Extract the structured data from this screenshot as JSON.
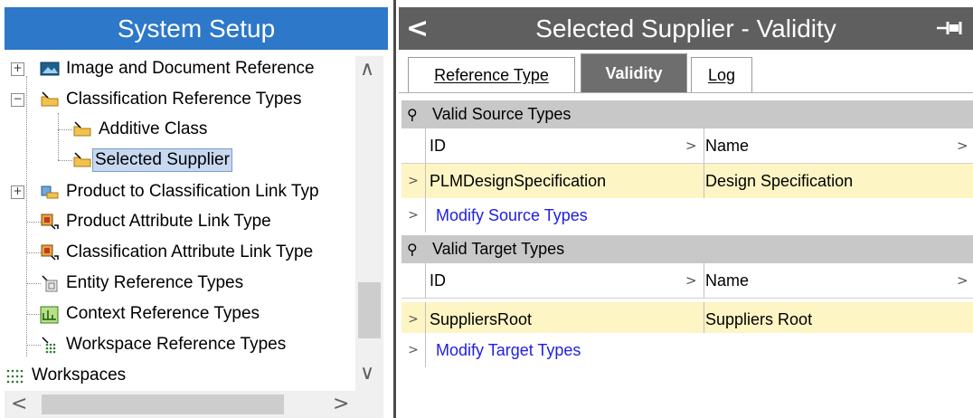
{
  "left": {
    "title": "System Setup",
    "tree": [
      {
        "label": "Image and Document Reference",
        "icon": "image-icon",
        "expander": "+"
      },
      {
        "label": "Classification Reference Types",
        "icon": "folder-ref-icon",
        "expander": "-"
      },
      {
        "label": "Additive Class",
        "icon": "folder-ref-icon"
      },
      {
        "label": "Selected Supplier",
        "icon": "folder-ref-icon",
        "selected": true
      },
      {
        "label": "Product to Classification Link Typ",
        "icon": "product-link-icon",
        "expander": "+"
      },
      {
        "label": "Product Attribute Link Type",
        "icon": "attribute-link-icon"
      },
      {
        "label": "Classification Attribute Link Type",
        "icon": "attribute-link-icon"
      },
      {
        "label": "Entity Reference Types",
        "icon": "entity-ref-icon"
      },
      {
        "label": "Context Reference Types",
        "icon": "context-ref-icon"
      },
      {
        "label": "Workspace Reference Types",
        "icon": "workspace-ref-icon"
      },
      {
        "label": "Workspaces",
        "icon": "workspaces-icon"
      }
    ]
  },
  "right": {
    "title": "Selected Supplier - Validity",
    "tabs": [
      {
        "label": "Reference Type"
      },
      {
        "label": "Validity",
        "active": true
      },
      {
        "label": "Log"
      }
    ],
    "source": {
      "heading": "Valid Source Types",
      "col_id": "ID",
      "col_name": "Name",
      "rows": [
        {
          "id": "PLMDesignSpecification",
          "name": "Design Specification"
        }
      ],
      "modify": "Modify Source Types"
    },
    "target": {
      "heading": "Valid Target Types",
      "col_id": "ID",
      "col_name": "Name",
      "rows": [
        {
          "id": "SuppliersRoot",
          "name": "Suppliers Root"
        }
      ],
      "modify": "Modify Target Types"
    }
  },
  "colors": {
    "left_header": "#2d78c8",
    "right_header": "#5f5f5f",
    "row_highlight": "#fdf5c4"
  }
}
